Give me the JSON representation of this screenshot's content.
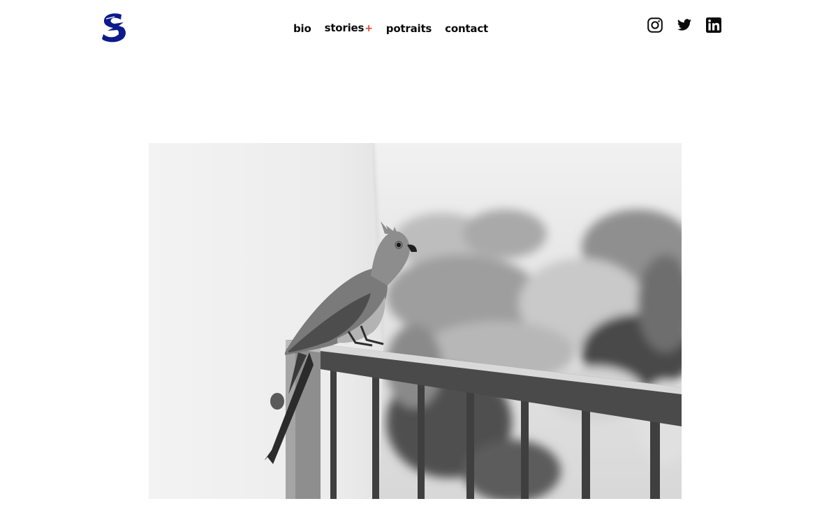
{
  "header": {
    "logo": {
      "icon": "s-bolt-logo-icon",
      "color": "#0d1a8c"
    },
    "nav": {
      "bio": "bio",
      "stories": "stories",
      "stories_plus": "+",
      "portraits": "potraits",
      "contact": "contact"
    },
    "nav_accent_color": "#e8432a",
    "social": [
      "instagram-icon",
      "twitter-icon",
      "linkedin-icon"
    ]
  },
  "hero": {
    "image": "black-and-white photo of a crested bird perched on a balcony railing"
  }
}
